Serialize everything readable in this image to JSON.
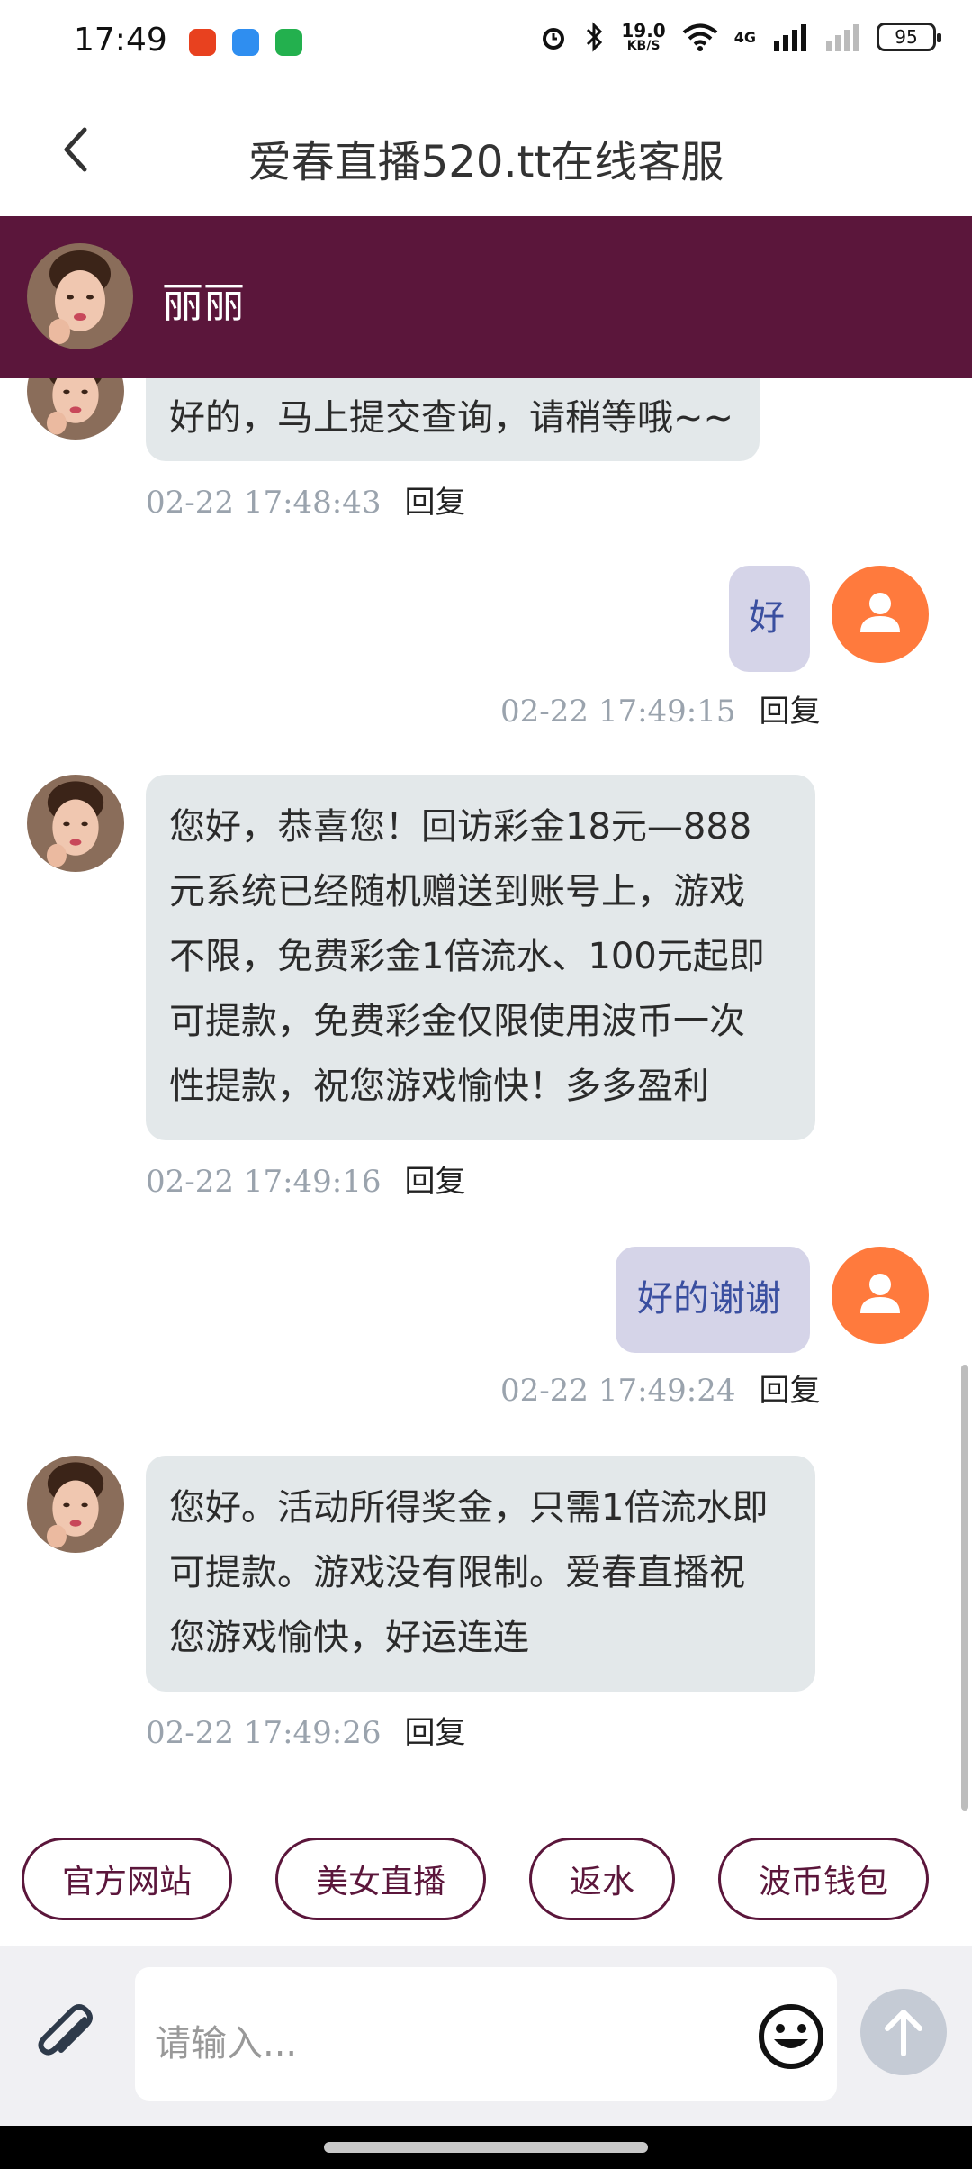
{
  "status_bar": {
    "time": "17:49",
    "network_speed_value": "19.0",
    "network_speed_unit": "KB/S",
    "signal_label": "4G",
    "battery": "95"
  },
  "title_bar": {
    "title": "爱春直播520.tt在线客服"
  },
  "agent": {
    "name": "丽丽"
  },
  "messages": [
    {
      "side": "in",
      "text": "好的，马上提交查询，请稍等哦~~",
      "time": "02-22 17:48:43",
      "reply": "回复"
    },
    {
      "side": "out",
      "text": "好",
      "time": "02-22 17:49:15",
      "reply": "回复"
    },
    {
      "side": "in",
      "lines": [
        "您好，恭喜您！回访彩金18元—888",
        "元系统已经随机赠送到账号上，游戏",
        "不限，免费彩金1倍流水、100元起即",
        "可提款，免费彩金仅限使用波币一次",
        "性提款，祝您游戏愉快！多多盈利"
      ],
      "time": "02-22 17:49:16",
      "reply": "回复"
    },
    {
      "side": "out",
      "text": "好的谢谢",
      "time": "02-22 17:49:24",
      "reply": "回复"
    },
    {
      "side": "in",
      "lines": [
        "您好。活动所得奖金，只需1倍流水即",
        "可提款。游戏没有限制。爱春直播祝",
        "您游戏愉快，好运连连"
      ],
      "time": "02-22 17:49:26",
      "reply": "回复"
    }
  ],
  "quick_actions": [
    "官方网站",
    "美女直播",
    "返水",
    "波币钱包"
  ],
  "input": {
    "placeholder": "请输入..."
  },
  "colors": {
    "brand": "#5b163b",
    "user_avatar": "#ff7a3d",
    "incoming_bubble": "#e3e8ea",
    "outgoing_bubble": "#d5d4e8"
  }
}
